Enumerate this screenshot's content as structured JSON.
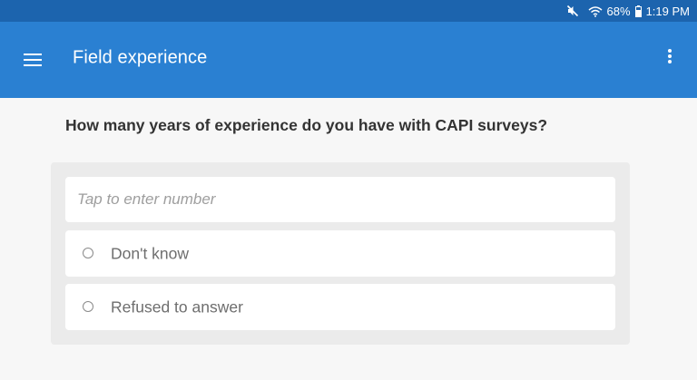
{
  "status_bar": {
    "battery": "68%",
    "time": "1:19 PM",
    "icons": [
      "mute-icon",
      "wifi-icon",
      "battery-icon"
    ]
  },
  "app_bar": {
    "title": "Field experience",
    "menu_icon": "hamburger-menu-icon",
    "overflow_icon": "more-vertical-icon"
  },
  "question": {
    "text": "How many years of experience do you have with CAPI surveys?",
    "input_placeholder": "Tap to enter number",
    "input_value": "",
    "options": [
      {
        "label": "Don't know",
        "selected": false
      },
      {
        "label": "Refused to answer",
        "selected": false
      }
    ]
  },
  "colors": {
    "status_bar": "#1c64ae",
    "app_bar": "#2a80d2",
    "background": "#f7f7f7",
    "panel": "#ebebeb"
  }
}
